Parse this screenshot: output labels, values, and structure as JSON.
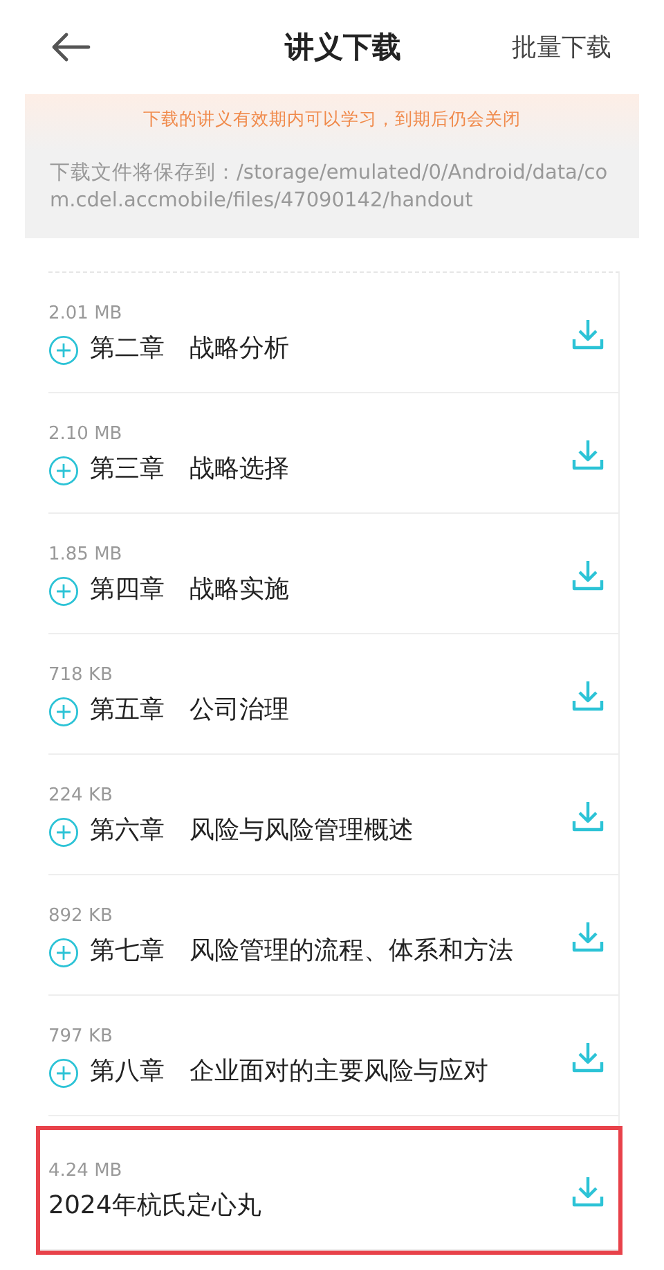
{
  "header": {
    "title": "讲义下载",
    "action": "批量下载"
  },
  "notice": {
    "warning": "下载的讲义有效期内可以学习，到期后仍会关闭",
    "path": "下载文件将保存到：/storage/emulated/0/Android/data/com.cdel.accmobile/files/47090142/handout"
  },
  "items": [
    {
      "size": "2.01 MB",
      "title": "第二章　战略分析",
      "expandable": true,
      "highlighted": false
    },
    {
      "size": "2.10 MB",
      "title": "第三章　战略选择",
      "expandable": true,
      "highlighted": false
    },
    {
      "size": "1.85 MB",
      "title": "第四章　战略实施",
      "expandable": true,
      "highlighted": false
    },
    {
      "size": "718 KB",
      "title": "第五章　公司治理",
      "expandable": true,
      "highlighted": false
    },
    {
      "size": "224 KB",
      "title": "第六章　风险与风险管理概述",
      "expandable": true,
      "highlighted": false
    },
    {
      "size": "892 KB",
      "title": "第七章　风险管理的流程、体系和方法",
      "expandable": true,
      "highlighted": false
    },
    {
      "size": "797 KB",
      "title": "第八章　企业面对的主要风险与应对",
      "expandable": true,
      "highlighted": false
    },
    {
      "size": "4.24 MB",
      "title": "2024年杭氏定心丸",
      "expandable": false,
      "highlighted": true
    }
  ]
}
